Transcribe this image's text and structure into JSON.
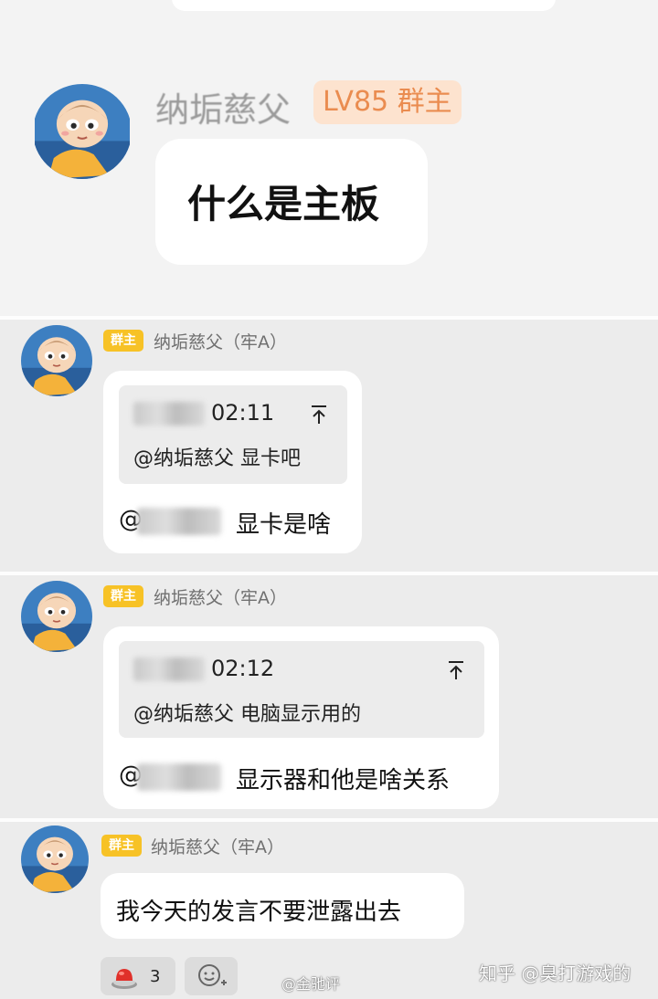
{
  "post": {
    "author": "纳垢慈父",
    "badge": "LV85 群主",
    "message": "什么是主板"
  },
  "messages": [
    {
      "owner_tag": "群主",
      "sender": "纳垢慈父（牢A）",
      "quote_time": "02:11",
      "quote_text": "@纳垢慈父 显卡吧",
      "reply_prefix": "@",
      "reply_text": "显卡是啥"
    },
    {
      "owner_tag": "群主",
      "sender": "纳垢慈父（牢A）",
      "quote_time": "02:12",
      "quote_text": "@纳垢慈父 电脑显示用的",
      "reply_prefix": "@",
      "reply_text": "显示器和他是啥关系"
    },
    {
      "owner_tag": "群主",
      "sender": "纳垢慈父（牢A）",
      "text": "我今天的发言不要泄露出去"
    }
  ],
  "reactions": {
    "count": "3"
  },
  "watermarks": {
    "weibo": "@金驰评",
    "zhihu": "知乎 @臭打游戏的"
  },
  "icons": {
    "avatar": "cartoon-child-avatar",
    "jump": "jump-to-top-icon",
    "reaction": "red-alarm-button-icon",
    "add_reaction": "add-emoji-icon"
  },
  "colors": {
    "owner_tag": "#f7c226",
    "lv_badge_bg": "#fde3cf",
    "lv_badge_text": "#ea8c50"
  }
}
